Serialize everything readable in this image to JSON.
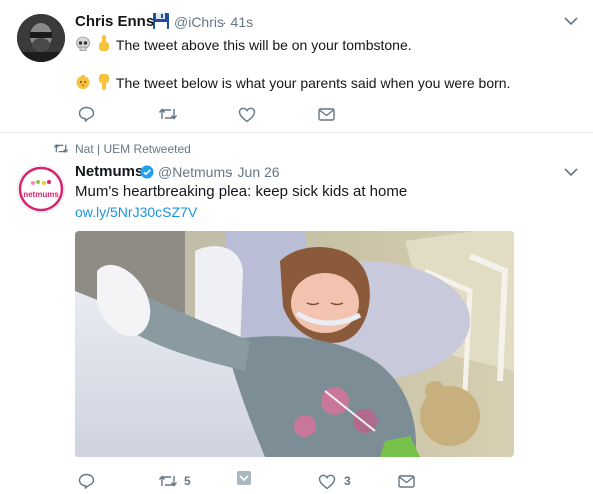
{
  "tweet1": {
    "name": "Chris Enns",
    "handle": "@iChris",
    "time": "· 41s",
    "line1": "The tweet above this will be on your tombstone.",
    "line2": "The tweet below is what your parents said when you were born.",
    "icons": [
      "reply-icon",
      "retweet-icon",
      "like-icon",
      "message-icon"
    ]
  },
  "tweet2": {
    "retweet_context": "Nat | UEM Retweeted",
    "name": "Netmums",
    "handle": "@Netmums",
    "time": "· Jun 26",
    "text": "Mum's heartbreaking plea: keep sick kids at home",
    "link": "ow.ly/5NrJ30cSZ7V",
    "avatar_label": "netmums",
    "retweet_count": "5",
    "like_count": "3"
  },
  "colors": {
    "accent": "#1b95e0",
    "muted": "#657786",
    "verified": "#1da1f2",
    "netmums_pink": "#d6246e"
  }
}
